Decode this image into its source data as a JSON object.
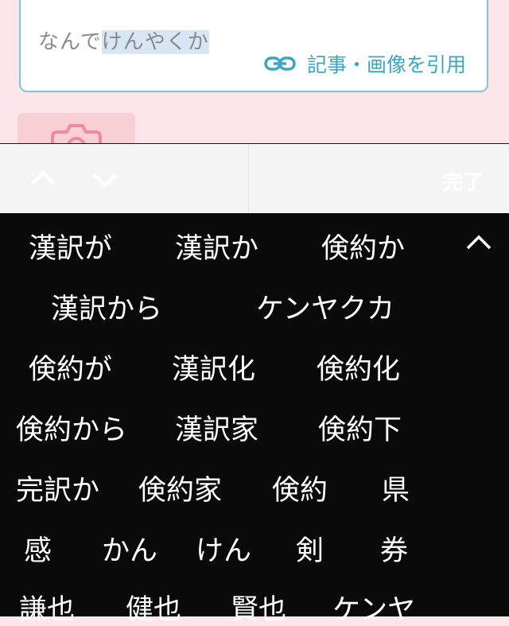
{
  "compose": {
    "input_text_prefix": "なんで",
    "input_text_selected": "けんやくか",
    "quote_label": "記事・画像を引用"
  },
  "accessory": {
    "done_label": "完了"
  },
  "candidates": {
    "row1": [
      "漢訳が",
      "漢訳か",
      "倹約か"
    ],
    "row2": [
      "漢訳から",
      "ケンヤクカ"
    ],
    "row3": [
      "倹約が",
      "漢訳化",
      "倹約化"
    ],
    "row4": [
      "倹約から",
      "漢訳家",
      "倹約下"
    ],
    "row5": [
      "完訳か",
      "倹約家",
      "倹約",
      "県"
    ],
    "row6": [
      "感",
      "かん",
      "けん",
      "剣",
      "券"
    ],
    "row7": [
      "謙也",
      "健也",
      "賢也",
      "ケンヤ"
    ]
  },
  "colors": {
    "accent": "#3aa7c2",
    "pink_bg": "#fde6ea",
    "candidate_bg": "#0a0a0a"
  },
  "icons": [
    "link-icon",
    "camera-icon",
    "chevron-up-icon",
    "chevron-down-icon",
    "collapse-chevron-icon"
  ]
}
